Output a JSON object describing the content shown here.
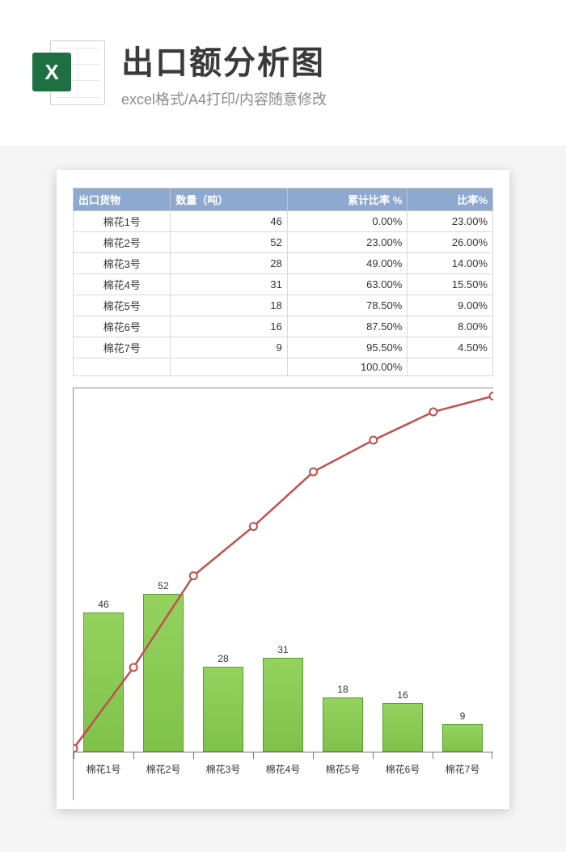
{
  "hero": {
    "icon_letter": "X",
    "title": "出口额分析图",
    "subtitle": "excel格式/A4打印/内容随意修改"
  },
  "table": {
    "headers": {
      "c1": "出口货物",
      "c2": "数量（吨）",
      "c3": "累计比率 %",
      "c4": "比率%"
    },
    "rows": [
      {
        "c1": "棉花1号",
        "c2": "46",
        "c3": "0.00%",
        "c4": "23.00%"
      },
      {
        "c1": "棉花2号",
        "c2": "52",
        "c3": "23.00%",
        "c4": "26.00%"
      },
      {
        "c1": "棉花3号",
        "c2": "28",
        "c3": "49.00%",
        "c4": "14.00%"
      },
      {
        "c1": "棉花4号",
        "c2": "31",
        "c3": "63.00%",
        "c4": "15.50%"
      },
      {
        "c1": "棉花5号",
        "c2": "18",
        "c3": "78.50%",
        "c4": "9.00%"
      },
      {
        "c1": "棉花6号",
        "c2": "16",
        "c3": "87.50%",
        "c4": "8.00%"
      },
      {
        "c1": "棉花7号",
        "c2": "9",
        "c3": "95.50%",
        "c4": "4.50%"
      }
    ],
    "footer_c3": "100.00%"
  },
  "chart_data": {
    "type": "bar",
    "categories": [
      "棉花1号",
      "棉花2号",
      "棉花3号",
      "棉花4号",
      "棉花5号",
      "棉花6号",
      "棉花7号"
    ],
    "series": [
      {
        "name": "数量（吨）",
        "type": "bar",
        "values": [
          46,
          52,
          28,
          31,
          18,
          16,
          9
        ],
        "color": "#8dcb58"
      },
      {
        "name": "累计比率 %",
        "type": "line",
        "values": [
          0,
          23,
          49,
          63,
          78.5,
          87.5,
          95.5,
          100
        ],
        "color": "#c0504d"
      }
    ],
    "y_bar_max": 120,
    "line_max": 100
  }
}
